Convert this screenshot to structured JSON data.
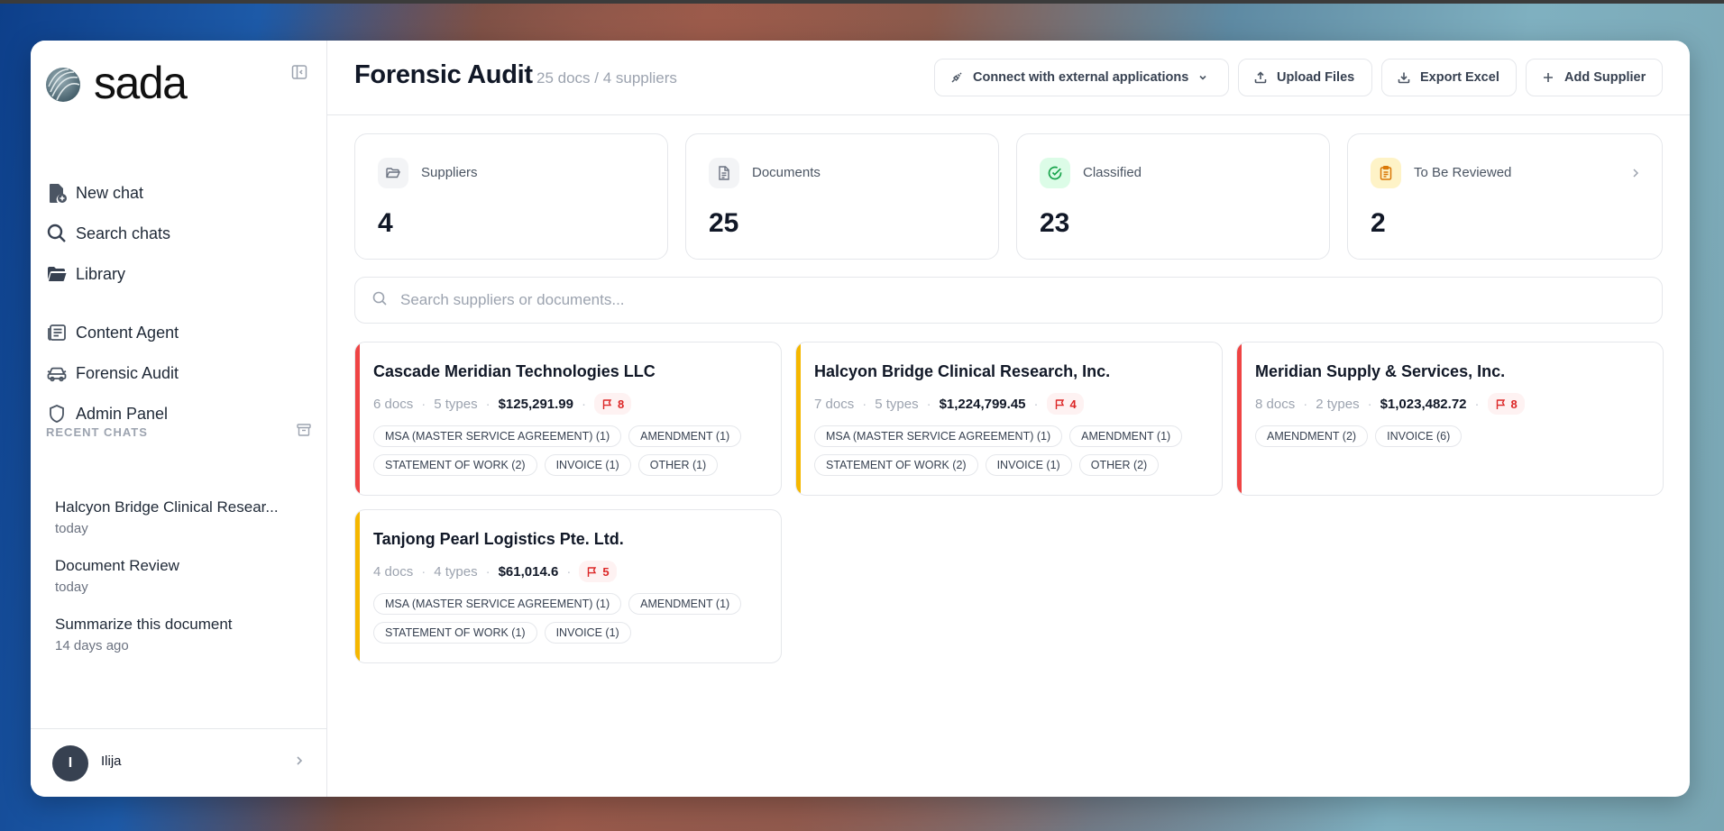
{
  "app": {
    "logo_text": "sada"
  },
  "sidebar": {
    "nav_primary": [
      {
        "label": "New chat",
        "icon": "new-chat-icon"
      },
      {
        "label": "Search chats",
        "icon": "search-icon"
      },
      {
        "label": "Library",
        "icon": "folder-icon"
      }
    ],
    "nav_secondary": [
      {
        "label": "Content Agent",
        "icon": "newspaper-icon"
      },
      {
        "label": "Forensic Audit",
        "icon": "car-icon"
      },
      {
        "label": "Admin Panel",
        "icon": "shield-icon"
      }
    ],
    "recent_label": "RECENT CHATS",
    "recent_chats": [
      {
        "title": "Halcyon Bridge Clinical Resear...",
        "time": "today"
      },
      {
        "title": "Document Review",
        "time": "today"
      },
      {
        "title": "Summarize this document",
        "time": "14 days ago"
      }
    ],
    "user": {
      "initial": "I",
      "name": "Ilija"
    }
  },
  "header": {
    "title": "Forensic Audit",
    "subtitle": "25 docs / 4 suppliers",
    "buttons": {
      "connect": "Connect with external applications",
      "upload": "Upload Files",
      "export": "Export Excel",
      "add": "Add Supplier"
    }
  },
  "stats": [
    {
      "label": "Suppliers",
      "value": "4",
      "icon": "folder-open-icon",
      "icon_bg": "#f3f4f6",
      "icon_color": "#6b7280"
    },
    {
      "label": "Documents",
      "value": "25",
      "icon": "document-icon",
      "icon_bg": "#f3f4f6",
      "icon_color": "#6b7280"
    },
    {
      "label": "Classified",
      "value": "23",
      "icon": "check-circle-icon",
      "icon_bg": "#dcfce7",
      "icon_color": "#16a34a"
    },
    {
      "label": "To Be Reviewed",
      "value": "2",
      "icon": "clipboard-icon",
      "icon_bg": "#fef3c7",
      "icon_color": "#d97706"
    }
  ],
  "search": {
    "placeholder": "Search suppliers or documents..."
  },
  "colors": {
    "accent_red": "#ef4444",
    "accent_amber": "#f5b700",
    "flag_red": "#dc2626"
  },
  "suppliers": [
    {
      "name": "Cascade Meridian Technologies LLC",
      "docs": "6 docs",
      "types": "5 types",
      "amount": "$125,291.99",
      "flags": "8",
      "accent": "#ef4444",
      "tags": [
        "MSA (MASTER SERVICE AGREEMENT) (1)",
        "AMENDMENT (1)",
        "STATEMENT OF WORK (2)",
        "INVOICE (1)",
        "OTHER (1)"
      ]
    },
    {
      "name": "Halcyon Bridge Clinical Research, Inc.",
      "docs": "7 docs",
      "types": "5 types",
      "amount": "$1,224,799.45",
      "flags": "4",
      "accent": "#f5b700",
      "tags": [
        "MSA (MASTER SERVICE AGREEMENT) (1)",
        "AMENDMENT (1)",
        "STATEMENT OF WORK (2)",
        "INVOICE (1)",
        "OTHER (2)"
      ]
    },
    {
      "name": "Meridian Supply & Services, Inc.",
      "docs": "8 docs",
      "types": "2 types",
      "amount": "$1,023,482.72",
      "flags": "8",
      "accent": "#ef4444",
      "tags": [
        "AMENDMENT (2)",
        "INVOICE (6)"
      ]
    },
    {
      "name": "Tanjong Pearl Logistics Pte. Ltd.",
      "docs": "4 docs",
      "types": "4 types",
      "amount": "$61,014.6",
      "flags": "5",
      "accent": "#f5b700",
      "tags": [
        "MSA (MASTER SERVICE AGREEMENT) (1)",
        "AMENDMENT (1)",
        "STATEMENT OF WORK (1)",
        "INVOICE (1)"
      ]
    }
  ]
}
